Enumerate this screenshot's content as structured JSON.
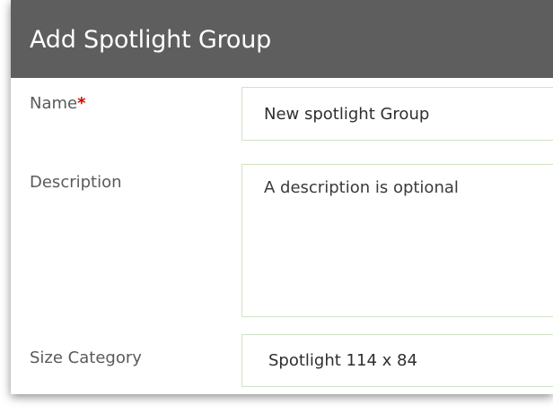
{
  "dialog": {
    "title": "Add Spotlight Group"
  },
  "form": {
    "name_label": "Name",
    "name_required_marker": "*",
    "name_value": "New spotlight Group",
    "description_label": "Description",
    "description_placeholder": "A description is optional",
    "description_value": "",
    "size_category_label": "Size Category",
    "size_category_selected": "Spotlight 114 x 84"
  },
  "colors": {
    "title_bar_bg": "#5e5e5e",
    "title_text": "#ffffff",
    "label_text": "#5a5a5a",
    "required_star": "#d40000",
    "field_border": "#cfe3c4"
  }
}
